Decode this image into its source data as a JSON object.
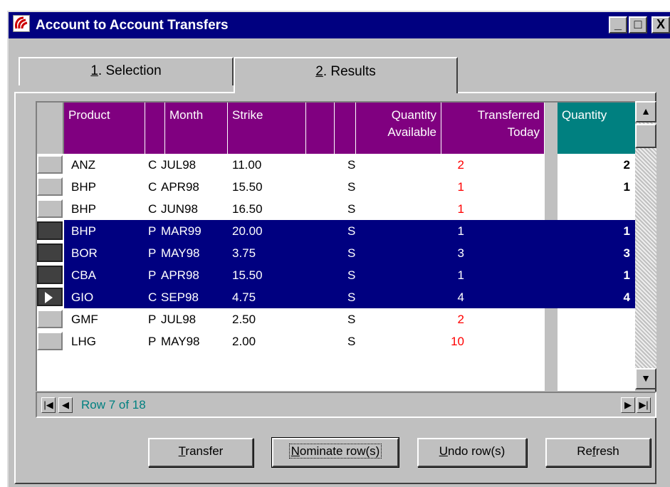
{
  "window": {
    "title": "Account to Account Transfers",
    "title_bar_color": "#000080",
    "controls": {
      "minimize": "_",
      "maximize": "□",
      "close": "X"
    }
  },
  "tabs": [
    {
      "mnemonic": "1",
      "label": ". Selection",
      "active": false
    },
    {
      "mnemonic": "2",
      "label": ". Results",
      "active": true
    }
  ],
  "grid": {
    "header_color": "#800080",
    "highlight_header_color": "#008080",
    "selection_color": "#000080",
    "columns": {
      "product": "Product",
      "month": "Month",
      "strike": "Strike",
      "quantity_available_1": "Quantity",
      "quantity_available_2": "Available",
      "transferred_today_1": "Transferred",
      "transferred_today_2": "Today",
      "quantity": "Quantity"
    },
    "rows": [
      {
        "product": "ANZ",
        "type": "C",
        "month": "JUL98",
        "strike": "11.00",
        "flag": "S",
        "available": "2",
        "available_red": true,
        "quantity": "2",
        "selected": false,
        "current": false
      },
      {
        "product": "BHP",
        "type": "C",
        "month": "APR98",
        "strike": "15.50",
        "flag": "S",
        "available": "1",
        "available_red": true,
        "quantity": "1",
        "selected": false,
        "current": false
      },
      {
        "product": "BHP",
        "type": "C",
        "month": "JUN98",
        "strike": "16.50",
        "flag": "S",
        "available": "1",
        "available_red": true,
        "quantity": "",
        "selected": false,
        "current": false
      },
      {
        "product": "BHP",
        "type": "P",
        "month": "MAR99",
        "strike": "20.00",
        "flag": "S",
        "available": "1",
        "available_red": false,
        "quantity": "1",
        "selected": true,
        "current": false
      },
      {
        "product": "BOR",
        "type": "P",
        "month": "MAY98",
        "strike": "3.75",
        "flag": "S",
        "available": "3",
        "available_red": false,
        "quantity": "3",
        "selected": true,
        "current": false
      },
      {
        "product": "CBA",
        "type": "P",
        "month": "APR98",
        "strike": "15.50",
        "flag": "S",
        "available": "1",
        "available_red": false,
        "quantity": "1",
        "selected": true,
        "current": false
      },
      {
        "product": "GIO",
        "type": "C",
        "month": "SEP98",
        "strike": "4.75",
        "flag": "S",
        "available": "4",
        "available_red": false,
        "quantity": "4",
        "selected": true,
        "current": true
      },
      {
        "product": "GMF",
        "type": "P",
        "month": "JUL98",
        "strike": "2.50",
        "flag": "S",
        "available": "2",
        "available_red": true,
        "quantity": "",
        "selected": false,
        "current": false
      },
      {
        "product": "LHG",
        "type": "P",
        "month": "MAY98",
        "strike": "2.00",
        "flag": "S",
        "available": "10",
        "available_red": true,
        "quantity": "",
        "selected": false,
        "current": false
      }
    ]
  },
  "navigator": {
    "row_info": "Row 7 of 18",
    "first_icon": "first-record-icon",
    "prev_icon": "prev-record-icon",
    "next_icon": "next-record-icon",
    "last_icon": "last-record-icon"
  },
  "buttons": {
    "transfer": {
      "mnemonic": "T",
      "rest": "ransfer"
    },
    "nominate": {
      "mnemonic": "N",
      "rest": "ominate row(s)"
    },
    "undo": {
      "mnemonic": "U",
      "rest": "ndo row(s)"
    },
    "refresh": {
      "pre": "Re",
      "mnemonic": "f",
      "rest": "resh"
    }
  }
}
